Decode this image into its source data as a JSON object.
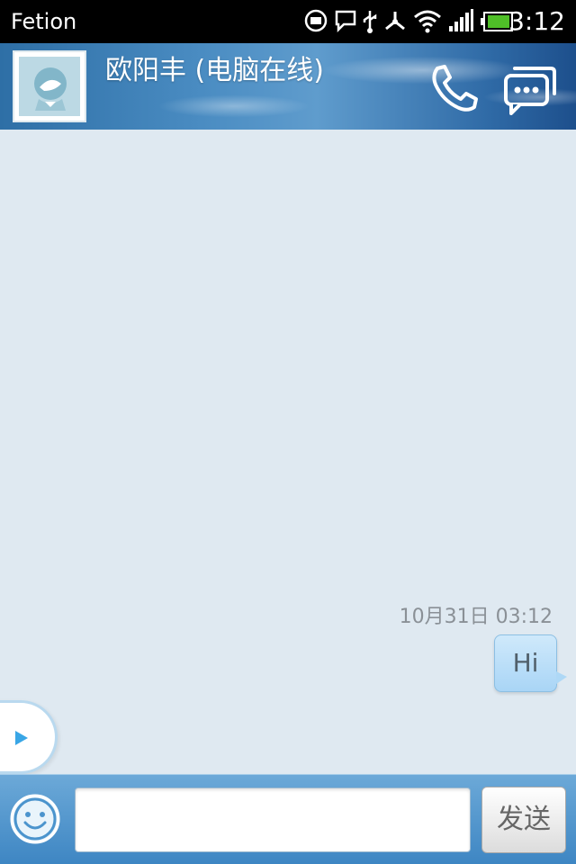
{
  "status_bar": {
    "app_name": "Fetion",
    "time": "3:12",
    "icons": [
      "app-notification-icon",
      "chat-notification-icon",
      "usb-icon",
      "debug-icon",
      "wifi-icon",
      "signal-icon",
      "battery-icon"
    ]
  },
  "header": {
    "contact_name": "欧阳丰 (电脑在线)",
    "avatar": "avatar-default",
    "call_icon": "phone-icon",
    "chat_list_icon": "chat-bubbles-icon"
  },
  "conversation": {
    "messages": [
      {
        "time": "10月31日  03:12",
        "text": "Hi",
        "direction": "outgoing"
      }
    ]
  },
  "input_bar": {
    "emoji_icon": "smiley-icon",
    "input_value": "",
    "input_placeholder": "",
    "send_label": "发送"
  },
  "colors": {
    "status_bar_bg": "#000000",
    "header_blue": "#2e6fa6",
    "chat_bg": "#dfe9f1",
    "bubble_blue": "#aed8f6",
    "input_bar_blue": "#4e93cb"
  }
}
